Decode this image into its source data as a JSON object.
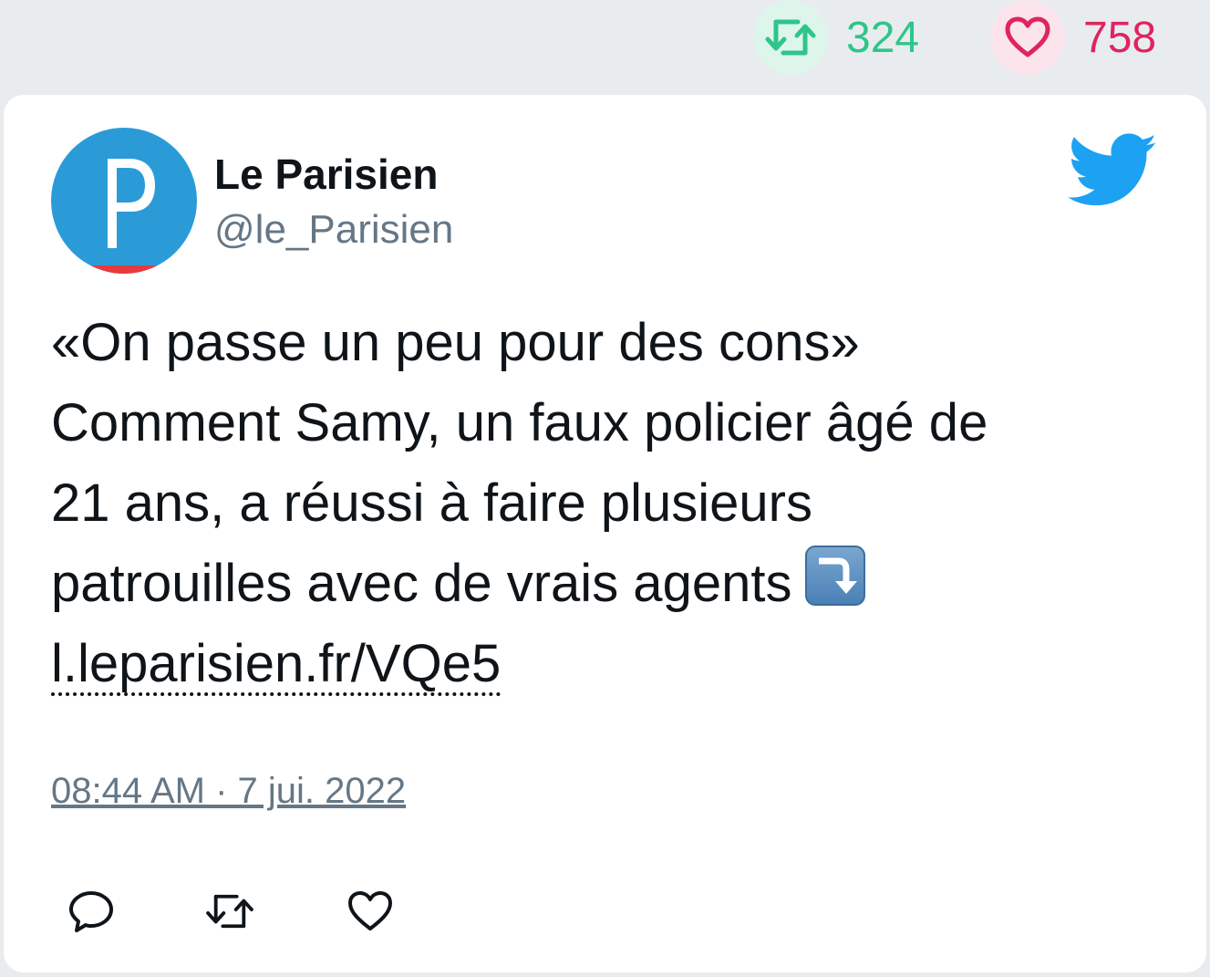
{
  "top_stats": {
    "retweet_count": "324",
    "like_count": "758",
    "retweet_color": "#2fc58a",
    "like_color": "#e0245e"
  },
  "tweet": {
    "author": {
      "name": "Le Parisien",
      "handle": "@le_Parisien",
      "avatar_letter": "P"
    },
    "text_lines": [
      "«On passe un peu pour des cons»",
      "Comment Samy, un faux policier âgé de",
      "21 ans, a réussi à faire plusieurs",
      "patrouilles avec de vrais agents"
    ],
    "emoji": "arrow-heading-down",
    "link": "l.leparisien.fr/VQe5",
    "timestamp": "08:44 AM · 7 jui. 2022"
  },
  "actions": {
    "icons": [
      "reply-icon",
      "retweet-icon",
      "like-icon"
    ]
  },
  "colors": {
    "brand_blue": "#1da1f2",
    "avatar_blue": "#2b9bd8",
    "avatar_red": "#e8393c",
    "muted_text": "#657786"
  }
}
